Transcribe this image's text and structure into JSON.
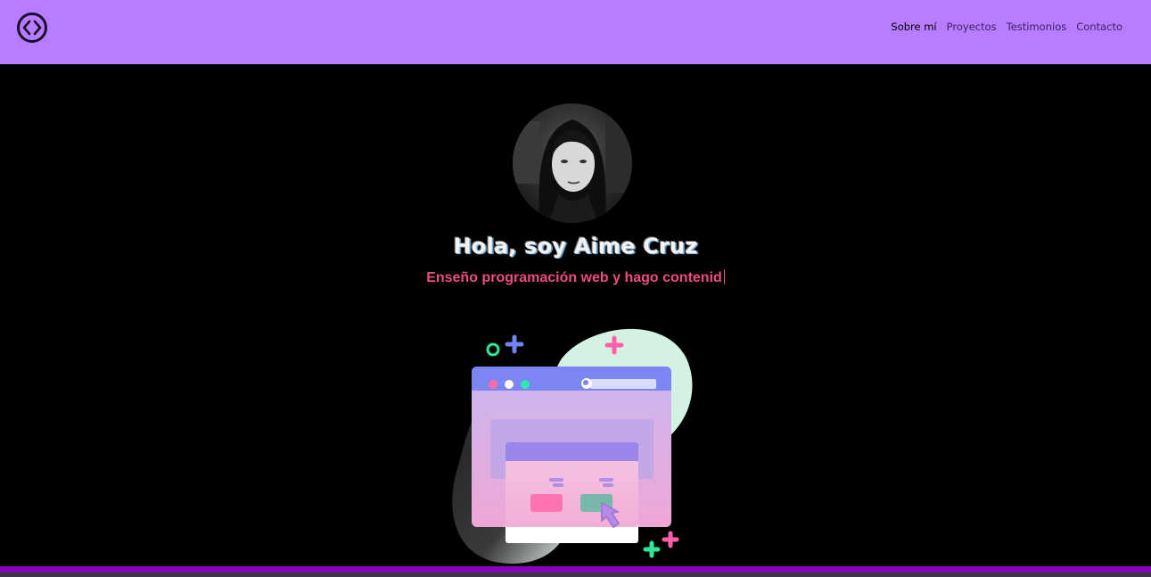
{
  "header": {
    "logo_icon": "code-brackets-icon",
    "nav": [
      {
        "label": "Sobre mí",
        "active": true
      },
      {
        "label": "Proyectos",
        "active": false
      },
      {
        "label": "Testimonios",
        "active": false
      },
      {
        "label": "Contacto",
        "active": false
      }
    ]
  },
  "hero": {
    "title": "Hola, soy Aime Cruz",
    "subtitle": "Enseño programación web y hago contenid"
  },
  "colors": {
    "navbar_bg": "#b77cff",
    "page_bg": "#000000",
    "subtitle": "#ee4b85",
    "footer_bar": "#8a00bf"
  }
}
